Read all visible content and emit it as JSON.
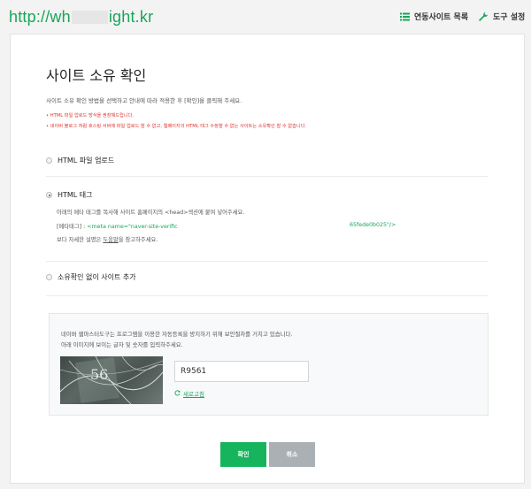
{
  "header": {
    "url_prefix": "http://wh",
    "url_suffix": "ight.kr",
    "sites_link": "연동사이트 목록",
    "tools_link": "도구 설정"
  },
  "main": {
    "title": "사이트 소유 확인",
    "description": "사이트 소유 확인 방법을 선택하고 안내에 따라 적용한 후 [확인]을 클릭해 주세요.",
    "notes": [
      "• HTML 파일 업로드 방식을 권장해드립니다.",
      "• 네이버 블로그 처럼 호스팅 서버에 파일 업로드 할 수 없고, 웹페이지의 HTML 태그 수정할 수 없는 사이트는 소유확인 할 수 없습니다."
    ],
    "options": [
      {
        "label": "HTML 파일 업로드",
        "selected": false
      },
      {
        "label": "HTML 태그",
        "selected": true
      },
      {
        "label": "소유확인 없이 사이트 추가",
        "selected": false
      }
    ],
    "html_tag": {
      "instruction": "아래의 메타 태그를 복사해 사이트 홈페이지의 <head>섹션에 붙여 넣어주세요.",
      "meta_label": "[메타태그] : ",
      "meta_code": "<meta name=\"naver-site-verific",
      "meta_tail": "65fede0b025\"/>",
      "help_prefix": "보다 자세한 설명은 ",
      "help_link": "도움말",
      "help_suffix": "을 참고하주세요."
    }
  },
  "captcha": {
    "line1": "네이버 웹마스터도구는 프로그램을 이용한 자동등록을 방지하기 위해 보안절차를 거치고 있습니다.",
    "line2": "아래 이미지에 보이는 글자 및 숫자를 입력하주세요.",
    "image_text": "56",
    "input_value": "R9561",
    "refresh_label": "새로고침"
  },
  "buttons": {
    "confirm": "확인",
    "cancel": "취소"
  },
  "colors": {
    "accent": "#17a65a",
    "confirm": "#17b45e",
    "cancel": "#aab0b4",
    "note": "#e0332a"
  }
}
